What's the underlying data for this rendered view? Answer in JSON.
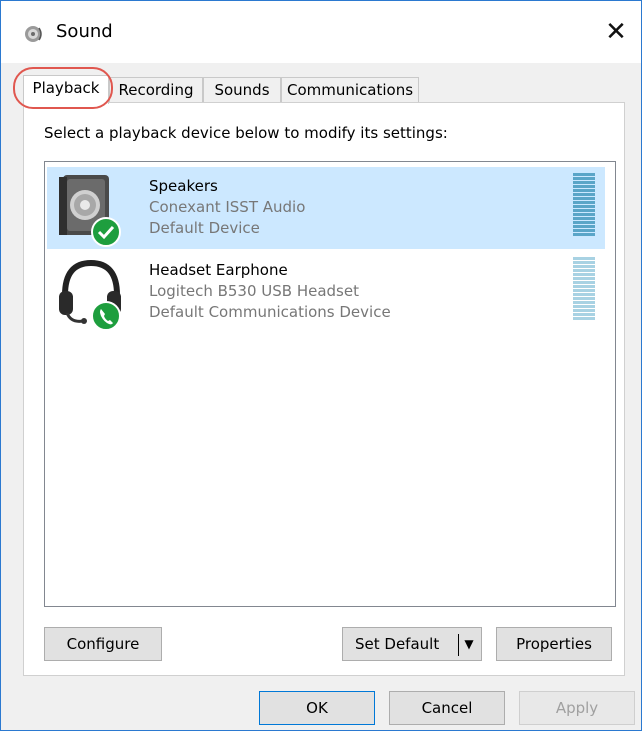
{
  "window": {
    "title": "Sound",
    "close_glyph": "✕"
  },
  "tabs": [
    {
      "label": "Playback",
      "active": true
    },
    {
      "label": "Recording"
    },
    {
      "label": "Sounds"
    },
    {
      "label": "Communications"
    }
  ],
  "playback": {
    "instructions": "Select a playback device below to modify its settings:",
    "devices": [
      {
        "name": "Speakers",
        "description": "Conexant ISST Audio",
        "status": "Default Device",
        "icon": "speaker-icon",
        "badge": "check-badge-icon",
        "selected": true
      },
      {
        "name": "Headset Earphone",
        "description": "Logitech B530 USB Headset",
        "status": "Default Communications Device",
        "icon": "headset-icon",
        "badge": "phone-badge-icon",
        "selected": false
      }
    ],
    "configure_label": "Configure",
    "set_default_label": "Set Default",
    "properties_label": "Properties"
  },
  "footer": {
    "ok_label": "OK",
    "cancel_label": "Cancel",
    "apply_label": "Apply"
  },
  "colors": {
    "accent": "#0078d7",
    "selection": "#cce8ff",
    "badge_green": "#1e9e3e",
    "annotation_red": "#e0574f"
  }
}
